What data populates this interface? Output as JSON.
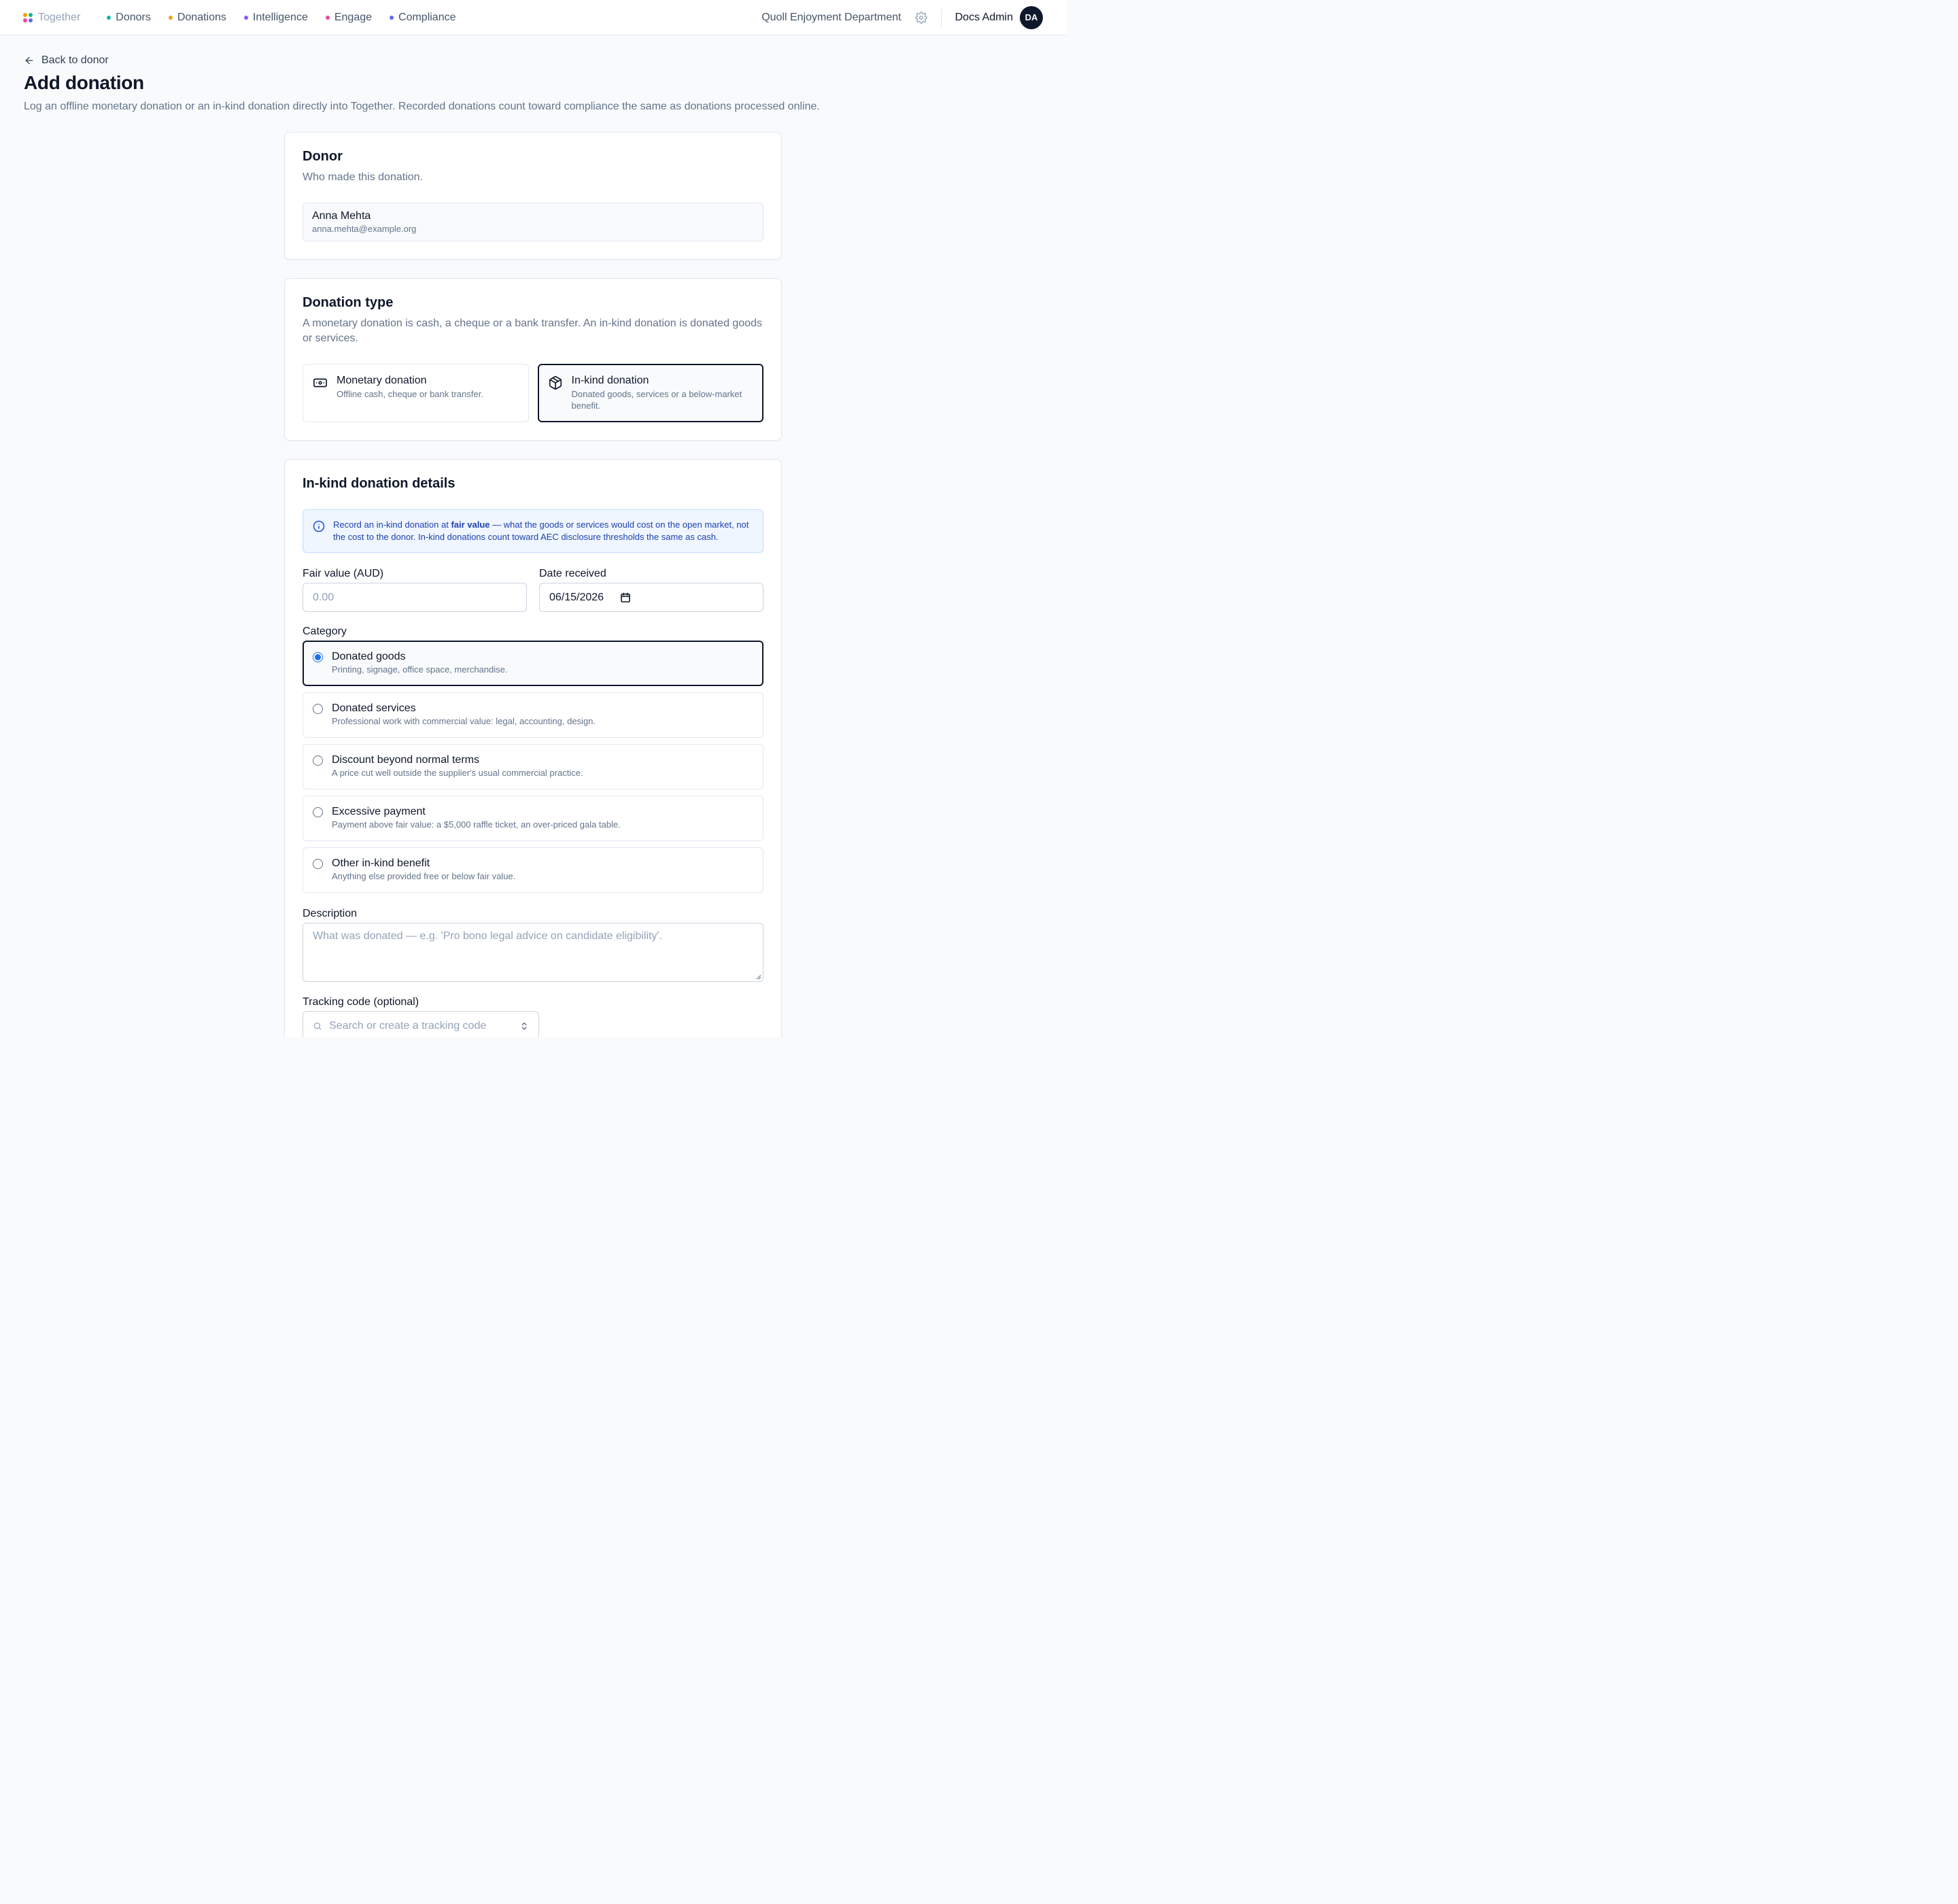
{
  "brand": {
    "name": "Together",
    "dot_colors": [
      "#f59e0b",
      "#10b981",
      "#ec4899",
      "#6366f1"
    ]
  },
  "nav": [
    {
      "label": "Donors",
      "color": "#14b8a6",
      "active": false
    },
    {
      "label": "Donations",
      "color": "#f59e0b",
      "active": true
    },
    {
      "label": "Intelligence",
      "color": "#8b5cf6",
      "active": false
    },
    {
      "label": "Engage",
      "color": "#ec4899",
      "active": false
    },
    {
      "label": "Compliance",
      "color": "#6366f1",
      "active": false
    }
  ],
  "org_name": "Quoll Enjoyment Department",
  "user": {
    "name": "Docs Admin",
    "initials": "DA"
  },
  "back_label": "Back to donor",
  "page": {
    "title": "Add donation",
    "subtitle": "Log an offline monetary donation or an in-kind donation directly into Together. Recorded donations count toward compliance the same as donations processed online."
  },
  "donor_card": {
    "title": "Donor",
    "desc": "Who made this donation.",
    "name": "Anna Mehta",
    "email": "anna.mehta@example.org"
  },
  "type_card": {
    "title": "Donation type",
    "desc": "A monetary donation is cash, a cheque or a bank transfer. An in-kind donation is donated goods or services.",
    "options": [
      {
        "title": "Monetary donation",
        "desc": "Offline cash, cheque or bank transfer.",
        "icon": "banknote-icon",
        "selected": false
      },
      {
        "title": "In-kind donation",
        "desc": "Donated goods, services or a below-market benefit.",
        "icon": "package-icon",
        "selected": true
      }
    ]
  },
  "details": {
    "title": "In-kind donation details",
    "info_pre": "Record an in-kind donation at ",
    "info_bold": "fair value",
    "info_post": " — what the goods or services would cost on the open market, not the cost to the donor. In-kind donations count toward AEC disclosure thresholds the same as cash.",
    "fair_value_label": "Fair value (AUD)",
    "fair_value_placeholder": "0.00",
    "date_label": "Date received",
    "date_value": "06/15/2026",
    "category_label": "Category",
    "categories": [
      {
        "title": "Donated goods",
        "desc": "Printing, signage, office space, merchandise.",
        "selected": true
      },
      {
        "title": "Donated services",
        "desc": "Professional work with commercial value: legal, accounting, design.",
        "selected": false
      },
      {
        "title": "Discount beyond normal terms",
        "desc": "A price cut well outside the supplier's usual commercial practice.",
        "selected": false
      },
      {
        "title": "Excessive payment",
        "desc": "Payment above fair value: a $5,000 raffle ticket, an over-priced gala table.",
        "selected": false
      },
      {
        "title": "Other in-kind benefit",
        "desc": "Anything else provided free or below fair value.",
        "selected": false
      }
    ],
    "description_label": "Description",
    "description_placeholder": "What was donated — e.g. 'Pro bono legal advice on candidate eligibility'.",
    "tracking_label": "Tracking code (optional)",
    "tracking_placeholder": "Search or create a tracking code"
  }
}
